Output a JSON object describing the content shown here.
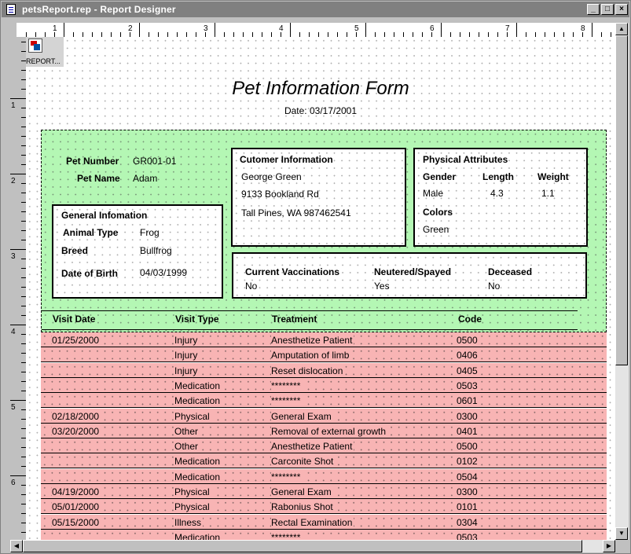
{
  "window": {
    "title": "petsReport.rep - Report Designer"
  },
  "ruler": {
    "top_numbers": [
      "1",
      "2",
      "3",
      "4",
      "5",
      "6",
      "7",
      "8"
    ],
    "left_numbers": [
      "1",
      "2",
      "3",
      "4",
      "5",
      "6"
    ]
  },
  "report_icon": {
    "label": "REPORT..."
  },
  "report": {
    "title": "Pet Information Form",
    "date": "Date: 03/17/2001",
    "pet": {
      "number_label": "Pet Number",
      "number": "GR001-01",
      "name_label": "Pet Name",
      "name": "Adam"
    },
    "customer": {
      "heading": "Cutomer Information",
      "name": "George Green",
      "address": "9133 Bookland Rd",
      "city": "Tall Pines, WA 987462541"
    },
    "physical": {
      "heading": "Physical Attributes",
      "gender_label": "Gender",
      "length_label": "Length",
      "weight_label": "Weight",
      "gender": "Male",
      "length": "4.3",
      "weight": "1.1",
      "colors_label": "Colors",
      "colors": "Green"
    },
    "general": {
      "heading": "General Infomation",
      "animal_type_label": "Animal Type",
      "animal_type": "Frog",
      "breed_label": "Breed",
      "breed": "Bullfrog",
      "dob_label": "Date of Birth",
      "dob": "04/03/1999"
    },
    "status": {
      "vacc_label": "Current Vaccinations",
      "vacc": "No",
      "neutered_label": "Neutered/Spayed",
      "neutered": "Yes",
      "deceased_label": "Deceased",
      "deceased": "No"
    },
    "visits": {
      "headers": [
        "Visit Date",
        "Visit Type",
        "Treatment",
        "Code"
      ],
      "rows": [
        [
          "01/25/2000",
          "Injury",
          "Anesthetize Patient",
          "0500"
        ],
        [
          "",
          "Injury",
          "Amputation of limb",
          "0406"
        ],
        [
          "",
          "Injury",
          "Reset dislocation",
          "0405"
        ],
        [
          "",
          "Medication",
          "********",
          "0503"
        ],
        [
          "",
          "Medication",
          "********",
          "0601"
        ],
        [
          "02/18/2000",
          "Physical",
          "General Exam",
          "0300"
        ],
        [
          "03/20/2000",
          "Other",
          "Removal of external growth",
          "0401"
        ],
        [
          "",
          "Other",
          "Anesthetize Patient",
          "0500"
        ],
        [
          "",
          "Medication",
          "Carconite Shot",
          "0102"
        ],
        [
          "",
          "Medication",
          "********",
          "0504"
        ],
        [
          "04/19/2000",
          "Physical",
          "General Exam",
          "0300"
        ],
        [
          "05/01/2000",
          "Physical",
          "Rabonius Shot",
          "0101"
        ],
        [
          "05/15/2000",
          "Illness",
          "Rectal Examination",
          "0304"
        ],
        [
          "",
          "Medication",
          "********",
          "0503"
        ]
      ]
    }
  },
  "colors": {
    "header_band": "#b4f7b4",
    "detail_band": "#f8b4b4",
    "titlebar": "#808080"
  }
}
